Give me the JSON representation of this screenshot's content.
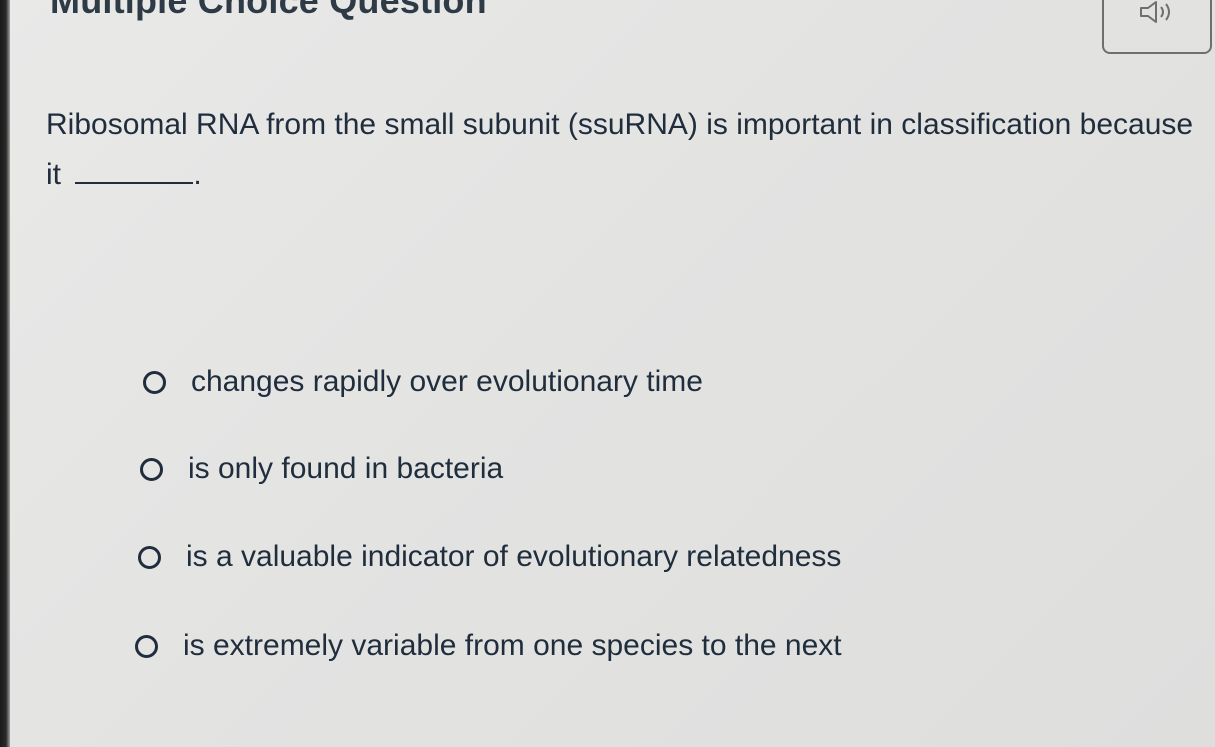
{
  "header": {
    "title": "Multiple Choice Question",
    "audio_icon": "speaker-icon"
  },
  "question": {
    "text_before_blank": "Ribosomal RNA from the small subunit (ssuRNA) is important in classification because it",
    "text_after_blank": "."
  },
  "options": [
    {
      "label": "changes rapidly over evolutionary time",
      "selected": false
    },
    {
      "label": "is only found in bacteria",
      "selected": false
    },
    {
      "label": "is a valuable indicator of evolutionary relatedness",
      "selected": false
    },
    {
      "label": "is extremely variable from one species to the next",
      "selected": false
    }
  ],
  "colors": {
    "text": "#1f2d3d",
    "background": "#e5e5e4",
    "button_border": "#6f6f6f"
  }
}
